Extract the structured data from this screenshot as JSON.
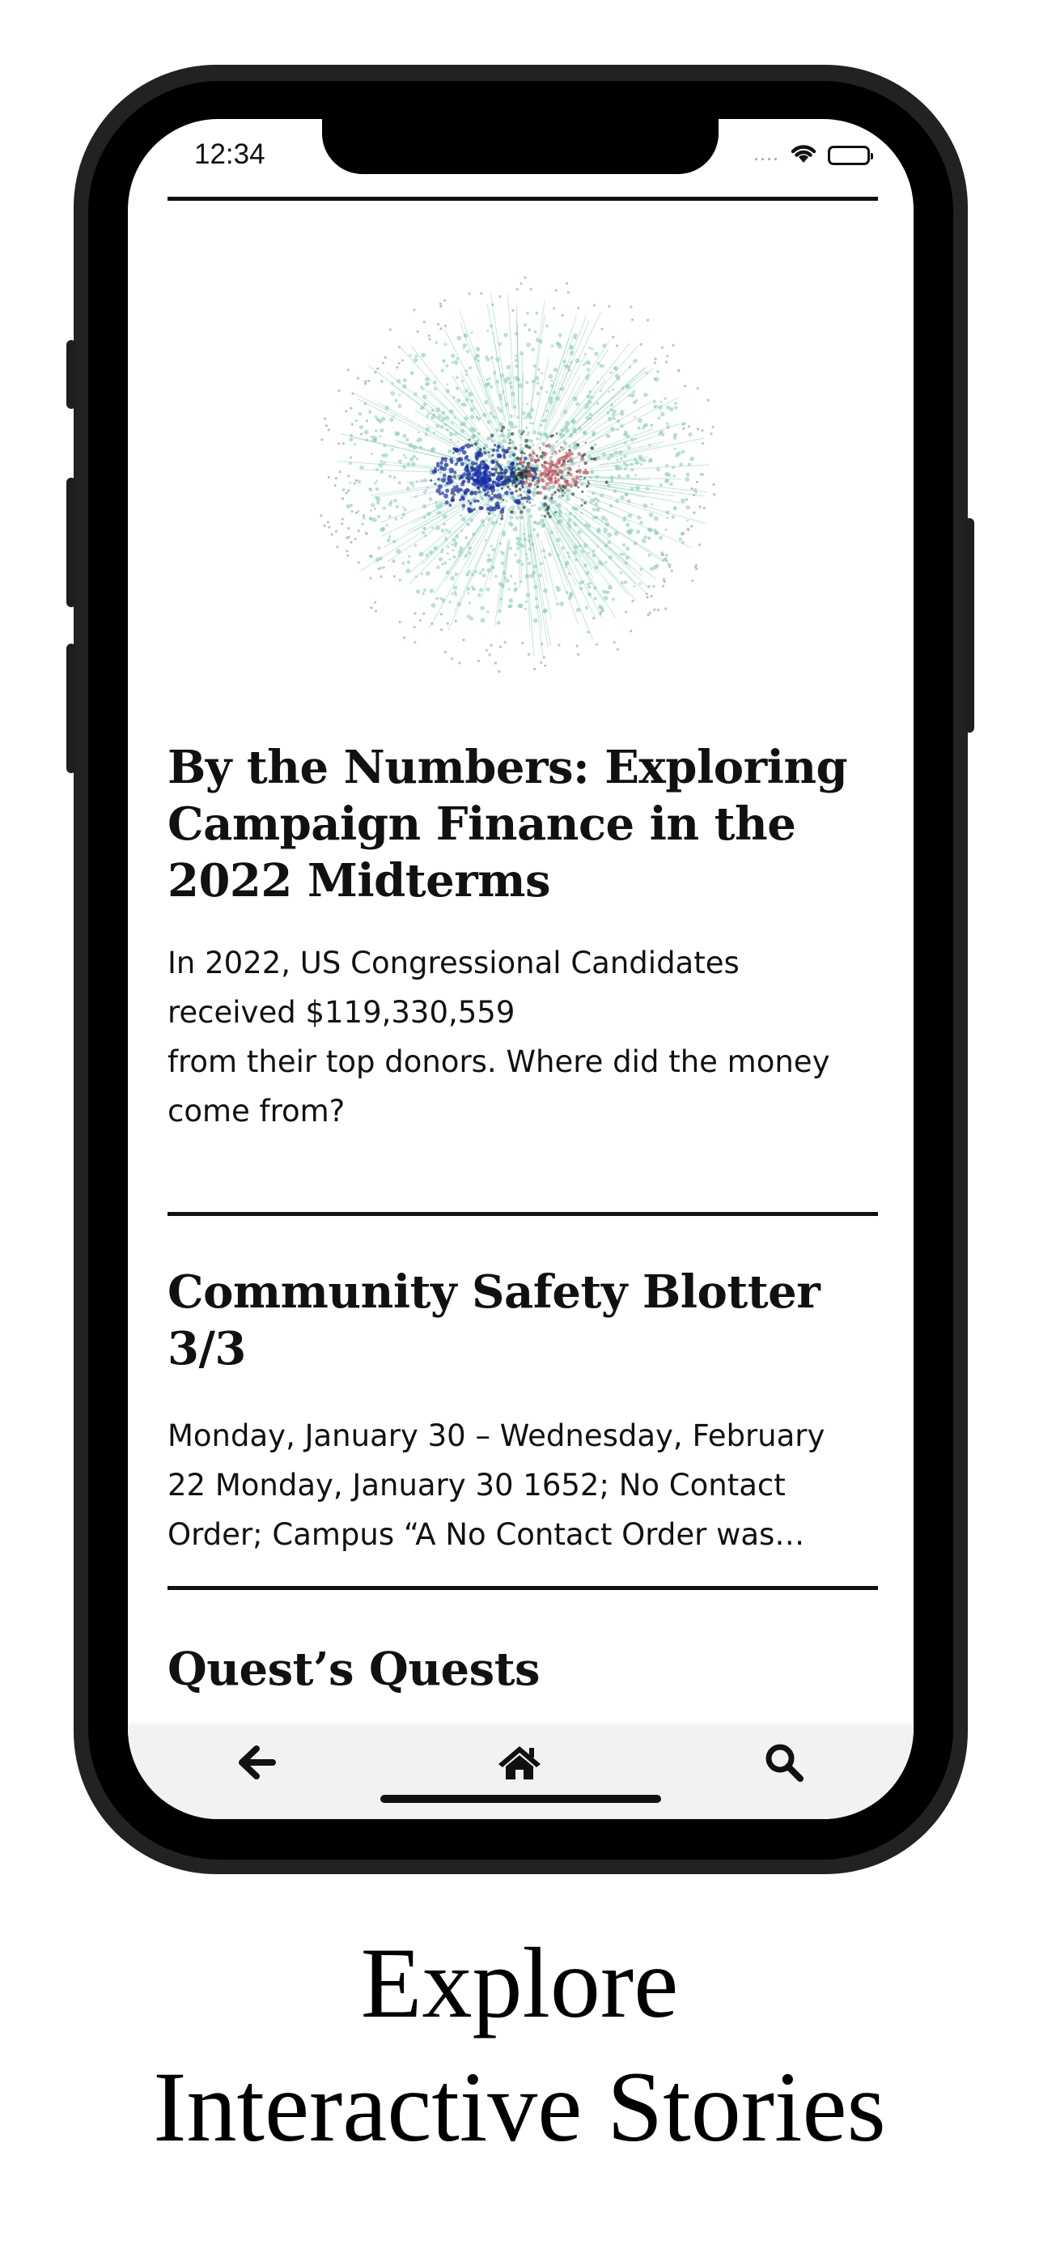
{
  "status_bar": {
    "time": "12:34",
    "signal": "....",
    "icons": [
      "wifi-icon",
      "battery-icon"
    ]
  },
  "stories": [
    {
      "image": "network-graph-image",
      "title_lines": [
        "By the Numbers: Exploring",
        "Campaign Finance in the",
        "2022 Midterms"
      ],
      "summary_lines": [
        "In 2022, US Congressional Candidates",
        "received $119,330,559",
        "from their top donors. Where did the money",
        "come from?"
      ]
    },
    {
      "title_lines": [
        "Community Safety Blotter",
        "3/3"
      ],
      "summary_lines": [
        "Monday, January 30 – Wednesday, February",
        "22 Monday, January 30 1652; No Contact",
        "Order; Campus “A No Contact Order was…"
      ]
    },
    {
      "title_lines": [
        "Quest’s Quests"
      ]
    }
  ],
  "tab_bar": {
    "items": [
      "back-arrow-icon",
      "home-icon",
      "search-icon"
    ]
  },
  "caption": {
    "line1": "Explore",
    "line2": "Interactive Stories"
  },
  "colors": {
    "text": "#111111",
    "frame": "#222222",
    "tab_bar_bg": "#f2f2f2",
    "graph_teal": "#7fc9b5",
    "graph_blue": "#1a2fa8",
    "graph_red": "#d0505a"
  }
}
